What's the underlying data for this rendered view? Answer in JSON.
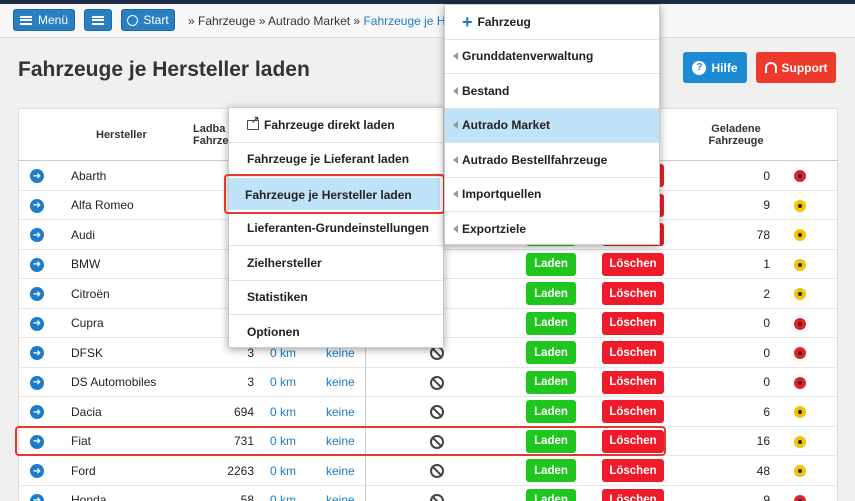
{
  "topbar": {
    "menu_label": "Menü",
    "start_label": "Start",
    "breadcrumb": {
      "prefix": "» Fahrzeuge » Autrado Market » ",
      "current": "Fahrzeuge je Hers"
    }
  },
  "page": {
    "title": "Fahrzeuge je Hersteller laden",
    "help_label": "Hilfe",
    "support_label": "Support"
  },
  "table": {
    "headers": {
      "hersteller": "Hersteller",
      "ladbar": "Ladba\nFahrze",
      "geladen": "Geladene\nFahrzeuge"
    },
    "rows": [
      {
        "name": "Abarth",
        "count": "",
        "km": "",
        "keine": "",
        "laden": "",
        "loeschen": "Löschen",
        "geladen": "0",
        "status": "red"
      },
      {
        "name": "Alfa Romeo",
        "count": "",
        "km": "",
        "keine": "",
        "laden": "",
        "loeschen": "Löschen",
        "geladen": "9",
        "status": "yellow"
      },
      {
        "name": "Audi",
        "count": "",
        "km": "",
        "keine": "",
        "laden": "Laden",
        "loeschen": "Löschen",
        "geladen": "78",
        "status": "yellow"
      },
      {
        "name": "BMW",
        "count": "",
        "km": "",
        "keine": "",
        "laden": "Laden",
        "loeschen": "Löschen",
        "geladen": "1",
        "status": "yellow"
      },
      {
        "name": "Citroën",
        "count": "",
        "km": "",
        "keine": "",
        "laden": "Laden",
        "loeschen": "Löschen",
        "geladen": "2",
        "status": "yellow"
      },
      {
        "name": "Cupra",
        "count": "",
        "km": "",
        "keine": "",
        "laden": "Laden",
        "loeschen": "Löschen",
        "geladen": "0",
        "status": "red"
      },
      {
        "name": "DFSK",
        "count": "3",
        "km": "0 km",
        "keine": "keine",
        "laden": "Laden",
        "loeschen": "Löschen",
        "geladen": "0",
        "status": "red"
      },
      {
        "name": "DS Automobiles",
        "count": "3",
        "km": "0 km",
        "keine": "keine",
        "laden": "Laden",
        "loeschen": "Löschen",
        "geladen": "0",
        "status": "red"
      },
      {
        "name": "Dacia",
        "count": "694",
        "km": "0 km",
        "keine": "keine",
        "laden": "Laden",
        "loeschen": "Löschen",
        "geladen": "6",
        "status": "yellow"
      },
      {
        "name": "Fiat",
        "count": "731",
        "km": "0 km",
        "keine": "keine",
        "laden": "Laden",
        "loeschen": "Löschen",
        "geladen": "16",
        "status": "yellow"
      },
      {
        "name": "Ford",
        "count": "2263",
        "km": "0 km",
        "keine": "keine",
        "laden": "Laden",
        "loeschen": "Löschen",
        "geladen": "48",
        "status": "yellow"
      },
      {
        "name": "Honda",
        "count": "58",
        "km": "0 km",
        "keine": "keine",
        "laden": "Laden",
        "loeschen": "Löschen",
        "geladen": "9",
        "status": "red"
      }
    ]
  },
  "menu_left": {
    "items": [
      "Fahrzeuge direkt laden",
      "Fahrzeuge je Lieferant laden",
      "Fahrzeuge je Hersteller laden",
      "Lieferanten-Grundeinstellungen",
      "Zielhersteller",
      "Statistiken",
      "Optionen"
    ]
  },
  "menu_right": {
    "items": [
      "Fahrzeug",
      "Grunddatenverwaltung",
      "Bestand",
      "Autrado Market",
      "Autrado Bestellfahrzeuge",
      "Importquellen",
      "Exportziele"
    ]
  },
  "colors": {
    "accent": "#2a7fc1",
    "laden": "#1ec61e",
    "loeschen": "#ee1c2a",
    "highlight": "#e03a2e"
  }
}
